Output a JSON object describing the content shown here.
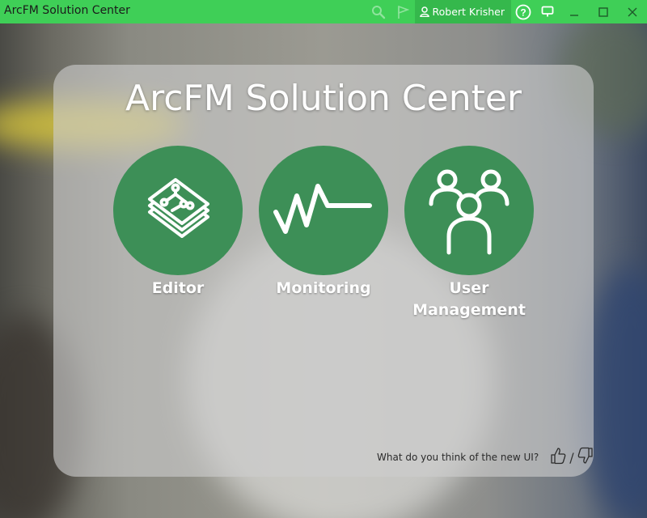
{
  "window": {
    "title": "ArcFM Solution Center",
    "user": "Robert Krisher"
  },
  "icons": {
    "search": "search-icon",
    "flag": "flag-icon",
    "user": "user-icon",
    "help": "help-icon",
    "chat": "chat-icon",
    "minimize": "minimize-icon",
    "maximize": "maximize-icon",
    "close": "close-icon",
    "thumbs_up": "thumbs-up-icon",
    "thumbs_down": "thumbs-down-icon"
  },
  "colors": {
    "titlebar": "#3fcf57",
    "user_box": "#35b84c",
    "tile": "#3d8f57"
  },
  "main": {
    "title": "ArcFM Solution Center",
    "tiles": [
      {
        "label": "Editor",
        "icon": "editor-layers-icon"
      },
      {
        "label": "Monitoring",
        "icon": "pulse-icon"
      },
      {
        "label_line1": "User",
        "label_line2": "Management",
        "icon": "users-icon"
      }
    ],
    "feedback": {
      "question": "What do you think of the new UI?",
      "separator": "/"
    }
  }
}
